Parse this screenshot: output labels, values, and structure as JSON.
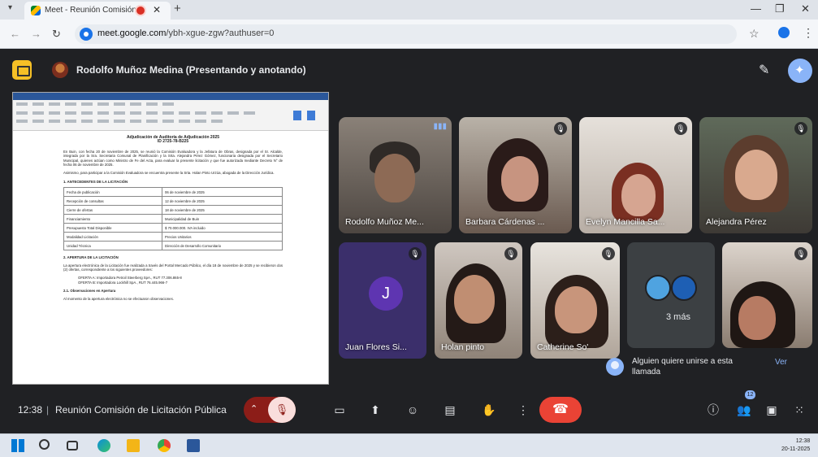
{
  "browser": {
    "tab_title": "Meet - Reunión Comisión",
    "url_host": "meet.google.com",
    "url_path": "/ybh-xgue-zgw?authuser=0"
  },
  "meet": {
    "presenter_label": "Rodolfo Muñoz Medina (Presentando y anotando)",
    "time": "12:38",
    "meeting_name": "Reunión Comisión de Licitación Pública",
    "participant_count_badge": "12",
    "more_label": "3 más",
    "join_request": {
      "text": "Alguien quiere unirse a esta llamada",
      "action": "Ver"
    }
  },
  "participants": [
    {
      "name": "Rodolfo Muñoz Me...",
      "state": "speaking"
    },
    {
      "name": "Barbara Cárdenas ...",
      "state": "muted"
    },
    {
      "name": "Evelyn Mancilla Sa...",
      "state": "muted"
    },
    {
      "name": "Alejandra Pérez",
      "state": "muted"
    },
    {
      "name": "Juan Flores Si...",
      "state": "muted",
      "initial": "J"
    },
    {
      "name": "Holan pinto",
      "state": "muted"
    },
    {
      "name": "Catherine So'",
      "state": "muted"
    },
    {
      "name": "",
      "state": "muted"
    }
  ],
  "document": {
    "title": "Adjudicación de Auditoría de Adjudicación 2025",
    "id": "ID 2725-78-B225",
    "intro": "En Buin, con fecha 20 de noviembre de 2025, se reunió la Comisión Evaluadora y la Jefatura de Obras, designada por el Sr. Alcalde, integrada por la Sra. Secretaria Comunal de Planificación y la Srta. Alejandra Pérez Gómez, funcionaria designada por el Secretario Municipal, quienes actúan como Ministro de Fe del Acta, para evaluar la presente licitación y que fue autorizada mediante Decreto N° de fecha 06 de noviembre de 2025.",
    "intro2": "Asimismo, para participar a la Comisión Evaluadora se encuentra presente la Srta. Holan Pinto Urzúa, abogada de la Dirección Jurídica.",
    "section1": "1.      ANTECEDENTES DE LA LICITACIÓN",
    "table_rows": [
      [
        "Fecha de publicación",
        "06 de noviembre de 2025"
      ],
      [
        "Recepción de consultas",
        "12 de noviembre de 2025"
      ],
      [
        "Cierre de ofertas",
        "18 de noviembre de 2025"
      ],
      [
        "Financiamiento",
        "Municipalidad de Buin"
      ],
      [
        "Presupuesto Total Disponible",
        "$ 70.000.000. IVA incluido"
      ],
      [
        "Modalidad Licitación",
        "Precios Unitarios"
      ],
      [
        "Unidad Técnica",
        "Dirección de Desarrollo Comunitario"
      ]
    ],
    "section2": "2.      APERTURA DE LA LICITACIÓN",
    "apertura": "La apertura electrónica de la Licitación fue realizada a través del Portal Mercado Público, el día 18 de noviembre de 2025 y se recibieron dos (2) ofertas, correspondiente a los siguientes proveedores:",
    "ofertas": [
      "OFERTA A: Importadora Petroil Steerberg SpA., RUT 77.306.865-8",
      "OFERTA B: Importadora Lockhill SpA., RUT 76.445.966-7"
    ],
    "section21": "2.1.    Observaciones en Apertura",
    "obs": "Al momento de la apertura electrónica no se efectuaron observaciones."
  },
  "taskbar": {
    "time": "12:38",
    "date": "20-11-2025"
  },
  "icons": {
    "presentation_badge": "present-to-all-icon",
    "annotate": "pen-icon",
    "gemini": "sparkle-icon",
    "mic": "mic-off-icon",
    "camera": "camera-icon",
    "present": "present-icon",
    "emoji": "emoji-icon",
    "captions": "captions-icon",
    "hand": "raise-hand-icon",
    "more": "more-vert-icon",
    "end_call": "end-call-icon",
    "info": "info-icon",
    "people": "people-icon",
    "chat": "chat-icon",
    "activities": "apps-icon"
  },
  "colors": {
    "meet_bg": "#202124",
    "end_call": "#ea4335",
    "mic_muted_bg": "#8c1d18",
    "accent": "#8ab4f8"
  }
}
